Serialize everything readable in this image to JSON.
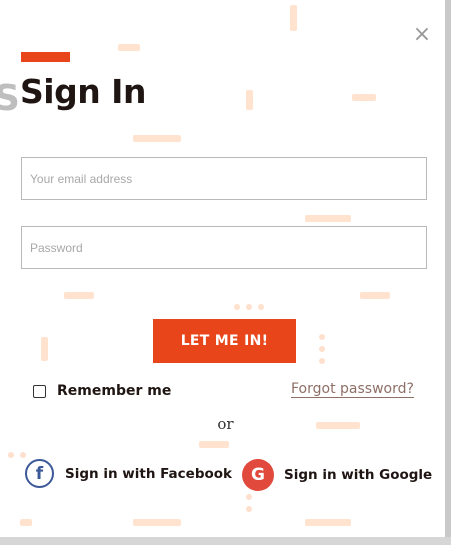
{
  "title": "Sign In",
  "close_glyph": "×",
  "email": {
    "placeholder": "Your email address",
    "value": ""
  },
  "password": {
    "placeholder": "Password",
    "value": ""
  },
  "submit_label": "LET ME IN!",
  "remember_label": "Remember me",
  "forgot_label": "Forgot password?",
  "or_label": "or",
  "facebook": {
    "label": "Sign in with Facebook",
    "glyph": "f",
    "icon": "facebook-icon",
    "color": "#3b5998"
  },
  "google": {
    "label": "Sign in with Google",
    "glyph": "G",
    "icon": "google-icon",
    "color": "#e0493b"
  },
  "colors": {
    "accent": "#e8451a",
    "text": "#1f1512",
    "link": "#8d6f66",
    "decoration": "#ffe3cf"
  }
}
